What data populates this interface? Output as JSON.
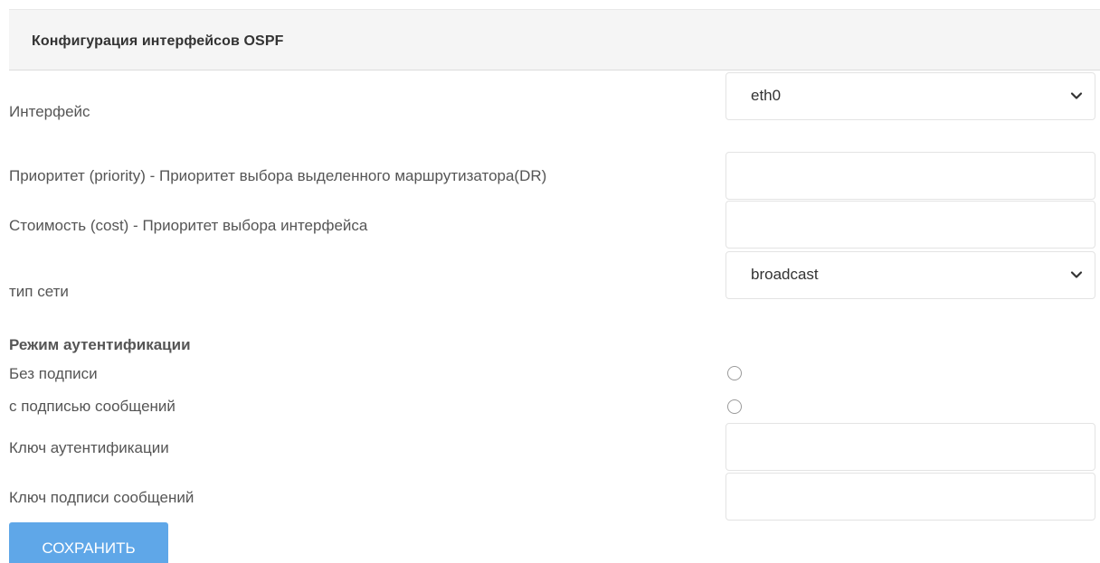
{
  "header": {
    "title": "Конфигурация интерфейсов OSPF"
  },
  "form": {
    "interface": {
      "label": "Интерфейс",
      "value": "eth0"
    },
    "priority": {
      "label": "Приоритет (priority) - Приоритет выбора выделенного маршрутизатора(DR)",
      "value": ""
    },
    "cost": {
      "label": "Стоимость (cost) - Приоритет выбора интерфейса",
      "value": ""
    },
    "network_type": {
      "label": "тип сети",
      "value": "broadcast"
    },
    "auth": {
      "title": "Режим аутентификации",
      "option_none": "Без подписи",
      "option_message": "с подписью сообщений"
    },
    "auth_key": {
      "label": "Ключ аутентификации",
      "value": ""
    },
    "message_key": {
      "label": "Ключ подписи сообщений",
      "value": ""
    }
  },
  "actions": {
    "save_label": "СОХРАНИТЬ"
  },
  "colors": {
    "accent": "#5fa7e8",
    "header_bg": "#f5f5f5",
    "text": "#555555",
    "border": "#e3e3e3"
  },
  "icons": {
    "dropdown": "chevron-down-icon"
  }
}
